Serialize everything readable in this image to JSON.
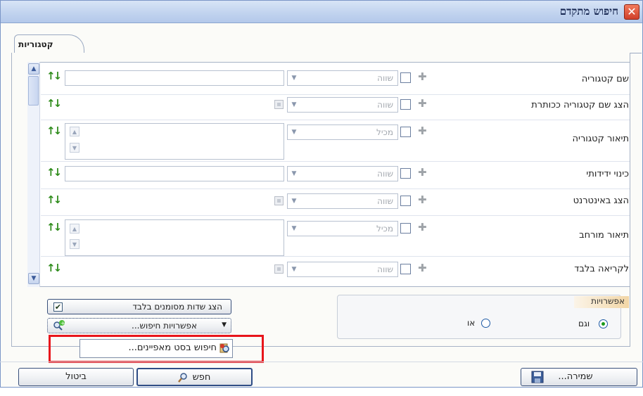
{
  "window": {
    "title": "חיפוש מתקדם"
  },
  "tabs": [
    {
      "label": "קטגוריות"
    }
  ],
  "rows": [
    {
      "label": "שם קטגוריה",
      "operator": "שווה"
    },
    {
      "label": "הצג שם קטגוריה ככותרת",
      "operator": "שווה"
    },
    {
      "label": "תיאור קטגוריה",
      "operator": "מכיל"
    },
    {
      "label": "כינוי ידידותי",
      "operator": "שווה"
    },
    {
      "label": "הצג באינטרנט",
      "operator": "שווה"
    },
    {
      "label": "תיאור מורחב",
      "operator": "מכיל"
    },
    {
      "label": "לקריאה בלבד",
      "operator": "שווה"
    }
  ],
  "options": {
    "legend": "אפשרויות",
    "and_label": "וגם",
    "or_label": "או",
    "selected": "and"
  },
  "show_marked_label": "הצג שדות מסומנים בלבד",
  "show_marked_checked": true,
  "search_options_label": "אפשרויות חיפוש...",
  "dropdown_item": "חיפוש בסט מאפיינים...",
  "buttons": {
    "cancel": "ביטול",
    "search": "חפש",
    "save": "שמירה..."
  },
  "icons": {
    "close": "close-icon",
    "sort": "sort-arrows-icon",
    "plus": "plus-icon",
    "search": "magnifier-icon",
    "save": "floppy-disk-icon",
    "property_set": "property-set-icon"
  },
  "colors": {
    "highlight": "#e8151b",
    "title_bar": "#c2d4ef",
    "sort_arrows": "#2f8c1c",
    "legend_accent": "#f2d6a6"
  }
}
